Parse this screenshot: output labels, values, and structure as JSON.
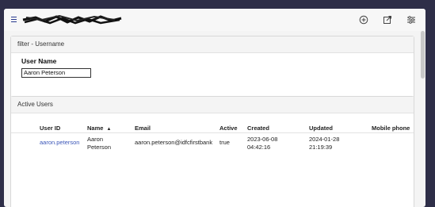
{
  "filter": {
    "title": "filter - Username",
    "field_label": "User Name",
    "field_value": "Aaron Peterson"
  },
  "users": {
    "title": "Active Users",
    "columns": [
      "User ID",
      "Name",
      "Email",
      "Active",
      "Created",
      "Updated",
      "Mobile phone"
    ],
    "sort_indicator": "▲",
    "row": {
      "user_id": "aaron.peterson",
      "name_line1": "Aaron",
      "name_line2": "Peterson",
      "email": "aaron.peterson@idfcfirstbank",
      "active": "true",
      "created_date": "2023-06-08",
      "created_time": "04:42:16",
      "updated_date": "2024-01-28",
      "updated_time": "21:19:39",
      "mobile": ""
    }
  },
  "icons": {
    "menu": "hamburger-icon",
    "add": "plus-circle-icon",
    "export": "export-icon",
    "settings": "sliders-icon"
  },
  "colors": {
    "link": "#3b56b8",
    "menu": "#2a3b8f",
    "background": "#2e2e48"
  }
}
